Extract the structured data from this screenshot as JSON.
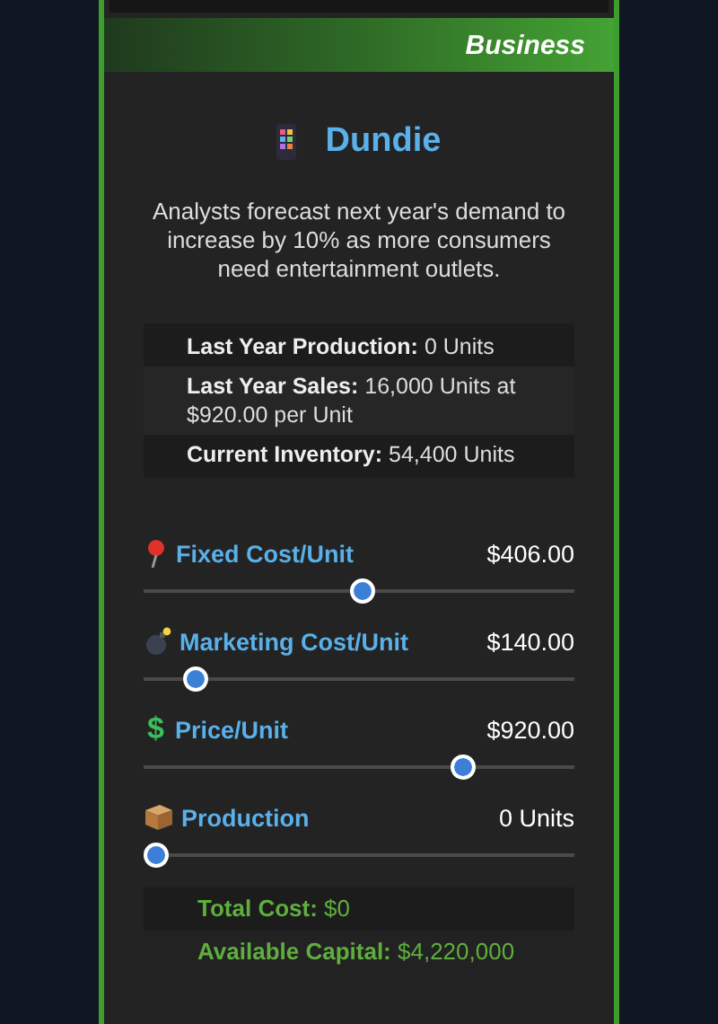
{
  "header": {
    "category": "Business"
  },
  "product": {
    "name": "Dundie",
    "description": "Analysts forecast next year's demand to increase by 10% as more consumers need entertainment outlets."
  },
  "stats": [
    "**Last Year Production:** 0 Units",
    "**Last Year Sales:** 16,000 Units at $920.00 per Unit",
    "**Current Inventory:** 54,400 Units"
  ],
  "sliders": [
    {
      "kind": "pin",
      "label": "Fixed Cost/Unit",
      "value": "$406.00",
      "level": 0.51
    },
    {
      "kind": "bomb",
      "label": "Marketing Cost/Unit",
      "value": "$140.00",
      "level": 0.12
    },
    {
      "kind": "glyph",
      "glyph": "$",
      "label": "Price/Unit",
      "value": "$920.00",
      "level": 0.74
    },
    {
      "kind": "box",
      "label": "Production",
      "value": "0 Units",
      "level": 0
    }
  ],
  "summary": [
    "**Total Cost:** $0",
    "**Available Capital:** $4,220,000"
  ]
}
